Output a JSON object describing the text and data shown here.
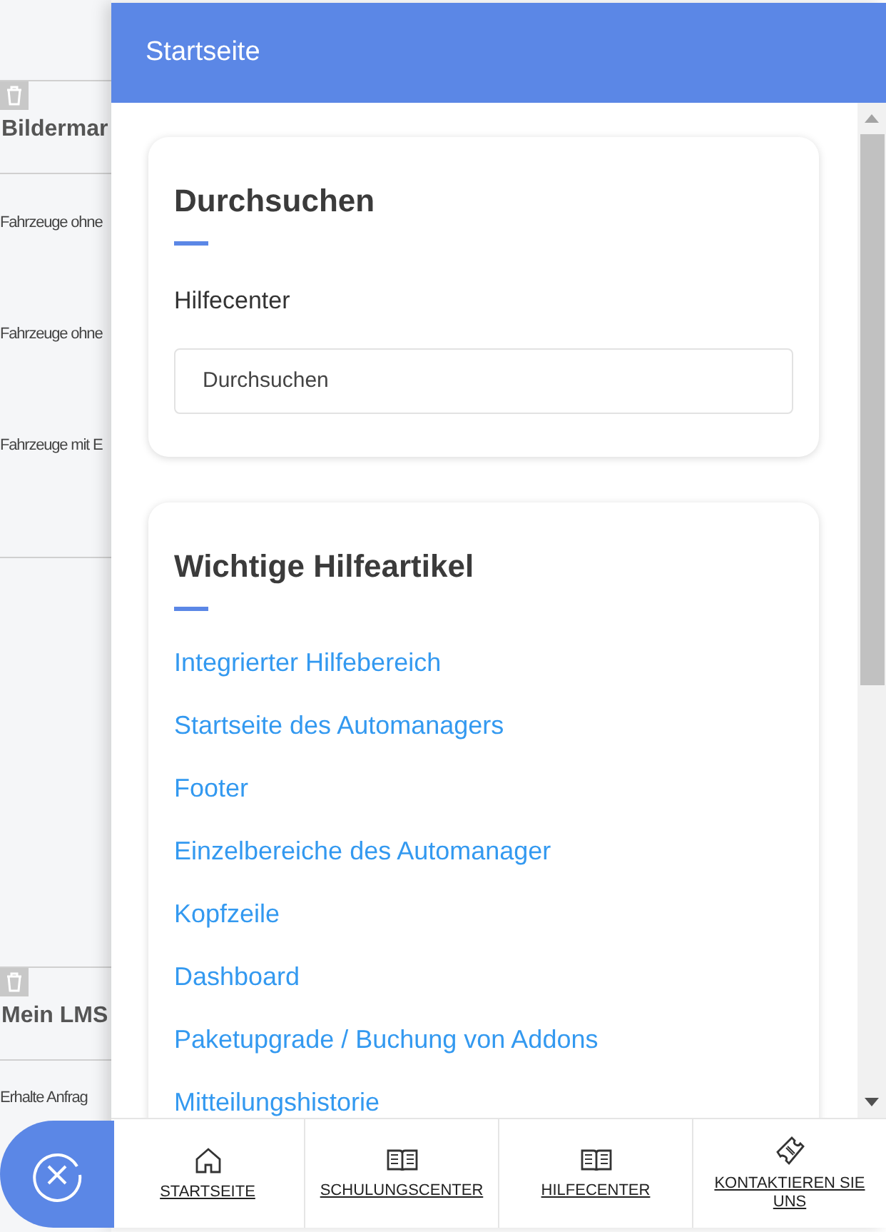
{
  "background": {
    "sections": [
      {
        "title": "Bildermar",
        "rows": [
          "Fahrzeuge ohne",
          "Fahrzeuge ohne",
          "Fahrzeuge mit E"
        ]
      },
      {
        "title": "Mein LMS",
        "rows": [
          "Erhalte Anfrag"
        ]
      }
    ]
  },
  "panel": {
    "title": "Startseite",
    "search_card": {
      "heading": "Durchsuchen",
      "label": "Hilfecenter",
      "placeholder": "Durchsuchen"
    },
    "articles_card": {
      "heading": "Wichtige Hilfeartikel",
      "links": [
        "Integrierter Hilfebereich",
        "Startseite des Automanagers",
        "Footer",
        "Einzelbereiche des Automanager",
        "Kopfzeile",
        "Dashboard",
        "Paketupgrade / Buchung von Addons",
        "Mitteilungshistorie"
      ]
    }
  },
  "bottom_nav": [
    {
      "label": "STARTSEITE",
      "kind": "home"
    },
    {
      "label": "SCHULUNGSCENTER",
      "kind": "book"
    },
    {
      "label": "HILFECENTER",
      "kind": "book"
    },
    {
      "label": "KONTAKTIEREN SIE UNS",
      "kind": "ticket"
    }
  ]
}
